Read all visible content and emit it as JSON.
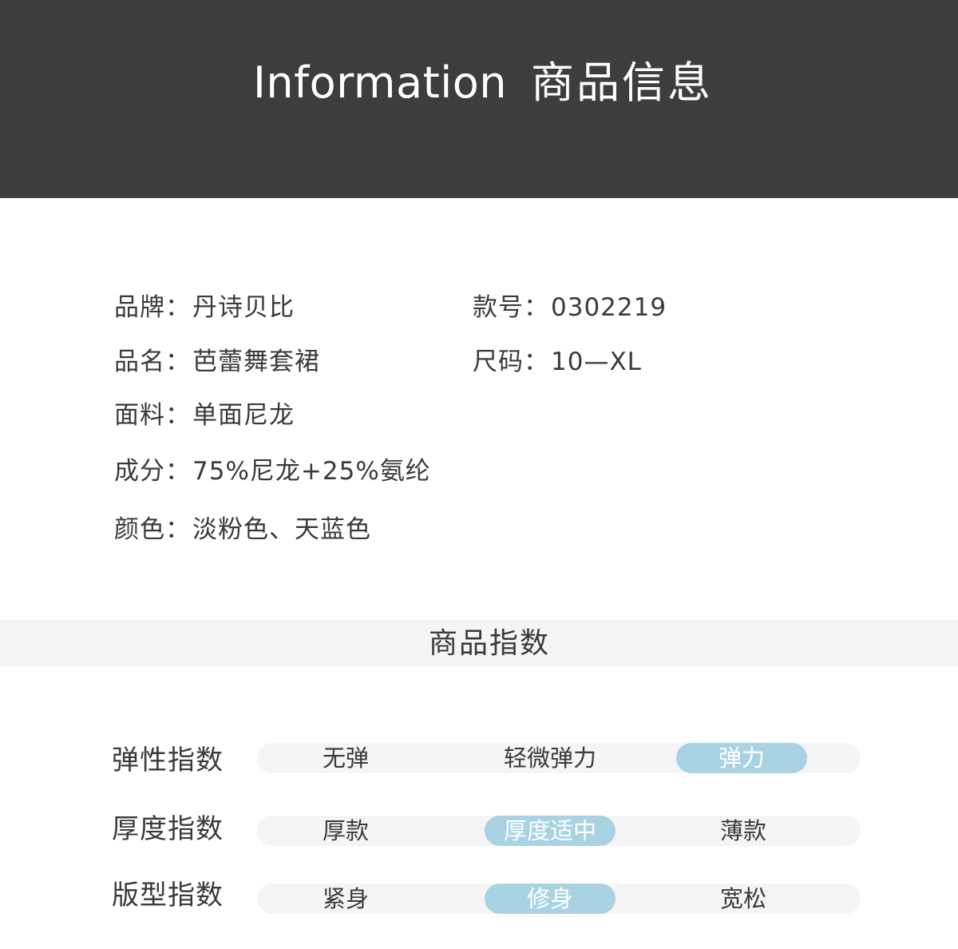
{
  "banner": {
    "title_en": "Information",
    "title_zh": "商品信息"
  },
  "info": {
    "brand_label": "品牌：",
    "brand_value": "丹诗贝比",
    "model_label": "款号：",
    "model_value": "0302219",
    "name_label": "品名：",
    "name_value": "芭蕾舞套裙",
    "size_label": "尺码：",
    "size_value": "10—XL",
    "fabric_label": "面料：",
    "fabric_value": "单面尼龙",
    "composition_label": "成分：",
    "composition_value": "75%尼龙+25%氨纶",
    "color_label": "颜色：",
    "color_value": "淡粉色、天蓝色"
  },
  "index": {
    "title": "商品指数",
    "metrics": [
      {
        "label": "弹性指数",
        "options": [
          "无弹",
          "轻微弹力",
          "弹力"
        ],
        "selected": 2
      },
      {
        "label": "厚度指数",
        "options": [
          "厚款",
          "厚度适中",
          "薄款"
        ],
        "selected": 1
      },
      {
        "label": "版型指数",
        "options": [
          "紧身",
          "修身",
          "宽松"
        ],
        "selected": 1
      }
    ]
  },
  "colors": {
    "banner_bg": "#3d3d3d",
    "selected_pill": "#a9d3e3",
    "track_bg": "#f5f5f5"
  }
}
